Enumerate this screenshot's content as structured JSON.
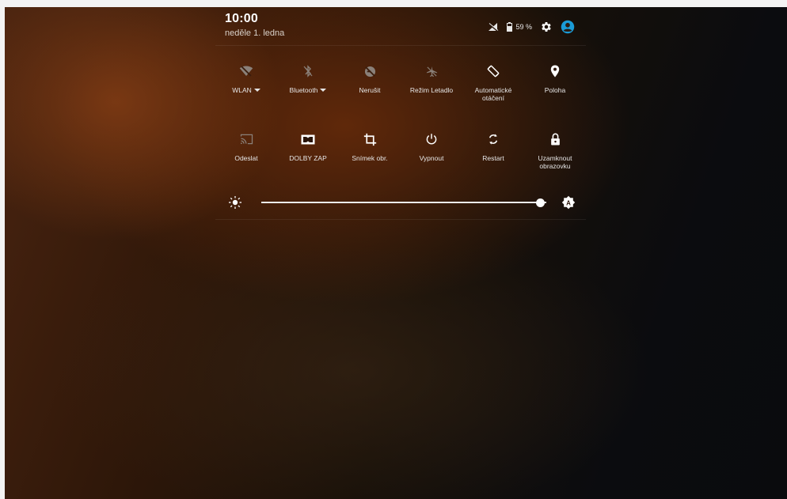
{
  "header": {
    "time": "10:00",
    "date": "neděle 1. ledna",
    "battery_text": "59 %",
    "battery_level_percent": 59
  },
  "tiles_row1": [
    {
      "label": "WLAN",
      "icon": "wifi-off-icon",
      "dropdown": true,
      "active": false
    },
    {
      "label": "Bluetooth",
      "icon": "bluetooth-off-icon",
      "dropdown": true,
      "active": false
    },
    {
      "label": "Nerušit",
      "icon": "do-not-disturb-off-icon",
      "dropdown": false,
      "active": false
    },
    {
      "label": "Režim Letadlo",
      "icon": "airplane-off-icon",
      "dropdown": false,
      "active": false
    },
    {
      "label": "Automatické otáčení",
      "icon": "auto-rotate-icon",
      "dropdown": false,
      "active": true
    },
    {
      "label": "Poloha",
      "icon": "location-icon",
      "dropdown": false,
      "active": true
    }
  ],
  "tiles_row2": [
    {
      "label": "Odeslat",
      "icon": "cast-icon",
      "active": false
    },
    {
      "label": "DOLBY ZAP",
      "icon": "dolby-icon",
      "active": true
    },
    {
      "label": "Snímek obr.",
      "icon": "crop-icon",
      "active": true
    },
    {
      "label": "Vypnout",
      "icon": "power-icon",
      "active": true
    },
    {
      "label": "Restart",
      "icon": "restart-icon",
      "active": true
    },
    {
      "label": "Uzamknout\nobrazovku",
      "icon": "lock-icon",
      "active": true
    }
  ],
  "brightness": {
    "level_fraction": 0.98,
    "auto_icon": "brightness-auto-icon"
  },
  "colors": {
    "active_icon": "#ffffff",
    "inactive_icon": "#8a8079",
    "accent": "#1a9bd7"
  }
}
